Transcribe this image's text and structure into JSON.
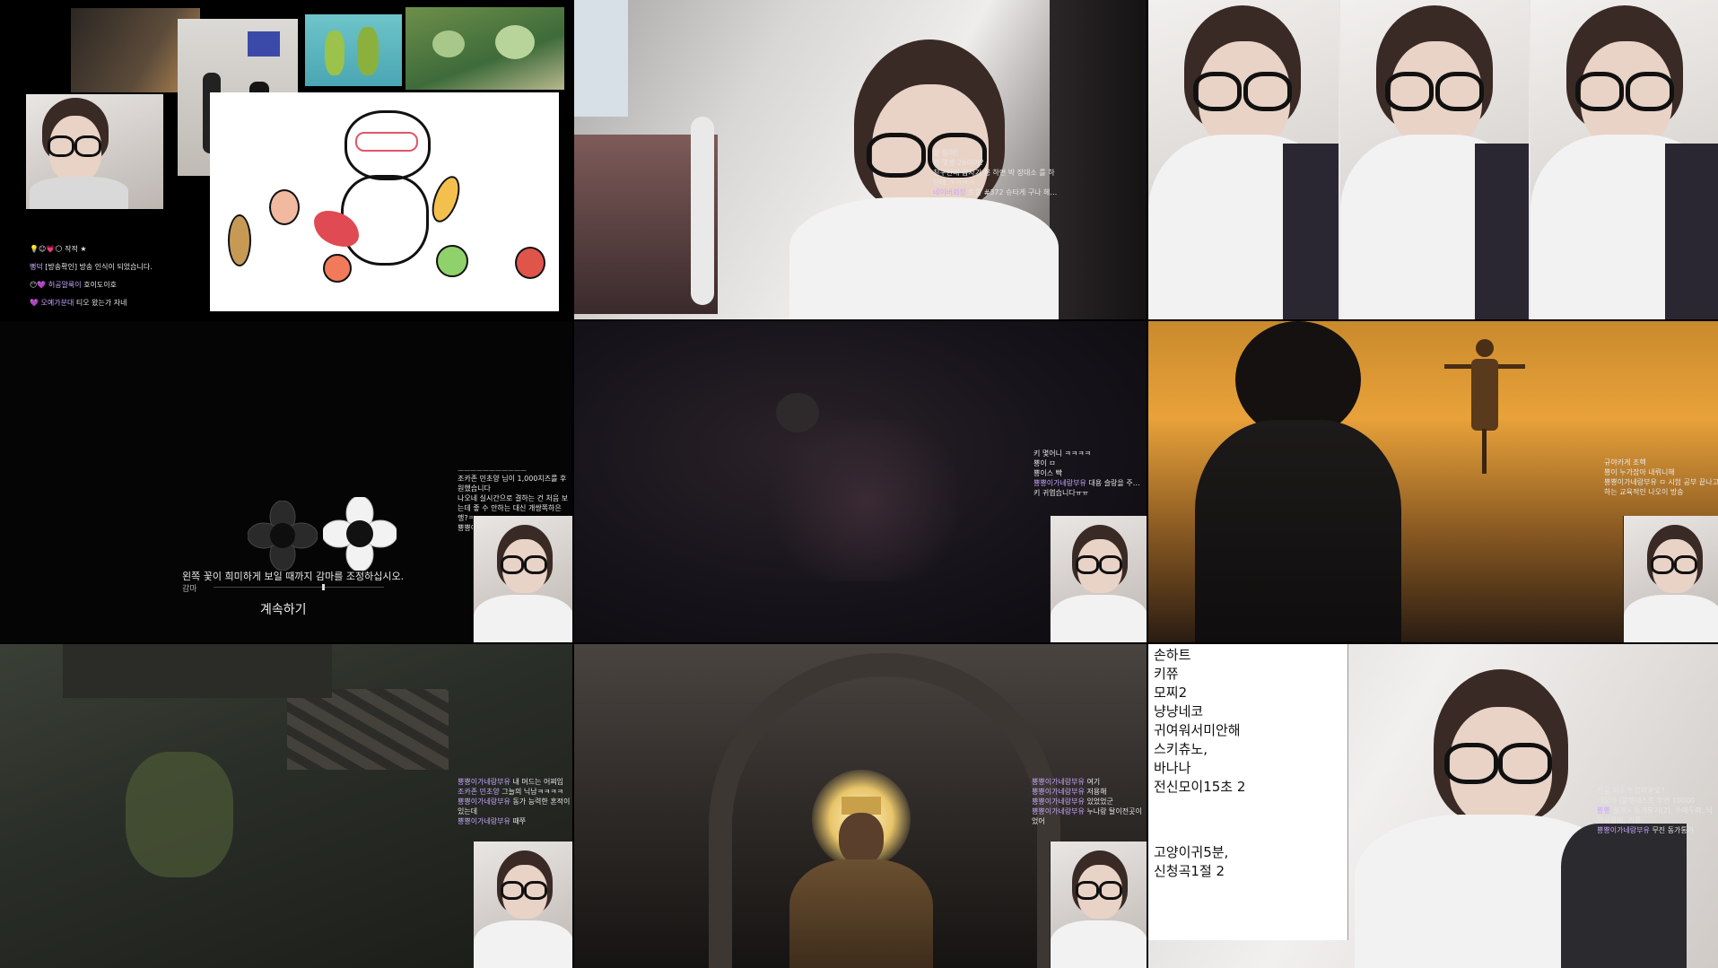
{
  "cells": {
    "c1": {
      "chat": [
        {
          "nick": "",
          "text": "작적"
        },
        {
          "nick": "뻥덕",
          "text": "[방송확인] 방송 인식이 되었습니다."
        },
        {
          "nick": "허공말룩이",
          "text": "호이도이호"
        },
        {
          "nick": "오예가분대",
          "text": "티오 왔는가 자네"
        }
      ]
    },
    "c2": {
      "chat": [
        {
          "nick": "",
          "text": "싶 용어!"
        },
        {
          "nick": "",
          "text": "키 몇짱 26이야?"
        },
        {
          "nick": "",
          "text": "친구한테 갑자기 뿅 하면 박 장대소 를 하던데 ㅋㅋㅋㅋ"
        },
        {
          "nick": "네이버회장",
          "text": "트롤 #372 슈타게 구나 헤뱃.."
        }
      ]
    },
    "c4": {
      "chat": [
        {
          "nick": "",
          "text": "조카존 민초양 님이 1,000치즈를 후원했습니다"
        },
        {
          "nick": "",
          "text": "나오네 실시간으로 결하는 건 처음 보는데 좋 수 안하는 대신 개쌍쪽하은 맹?ㅋㅋㅋㅋ"
        },
        {
          "nick": "",
          "text": "뿅뿅이가네랑부유 ㅁㅇ( ◍ )"
        }
      ],
      "gamma_instruction": "왼쪽 꽃이 희미하게 보일 때까지 감마를 조정하십시오.",
      "gamma_label": "감마",
      "continue_label": "계속하기"
    },
    "c5": {
      "chat": [
        {
          "nick": "",
          "text": "키 몇어니 ㅋㅋㅋㅋ"
        },
        {
          "nick": "",
          "text": "뿅이 ㅁ"
        },
        {
          "nick": "",
          "text": "뿅이스 빡"
        },
        {
          "nick": "뿅뿅이가네랑부유",
          "text": "대용 슬랑을 주기써"
        },
        {
          "nick": "",
          "text": "키 귀엽습니다ㅠㅠ"
        }
      ]
    },
    "c6": {
      "chat": [
        {
          "nick": "",
          "text": "규야카게 조헥"
        },
        {
          "nick": "",
          "text": "뿅이 누가잡아 내뤼니해"
        },
        {
          "nick": "",
          "text": "뿅뿅이가네랑부유 ㅁ 시험 공부 끝나고 하는 교육적인 나오이 방송"
        }
      ]
    },
    "c7": {
      "chat": [
        {
          "nick": "뿅뿅이가네랑부유",
          "text": "내 머드는 어찌임"
        },
        {
          "nick": "조카존 민초양",
          "text": "그늘의 닉남ㅋㅋㅋㅋ"
        },
        {
          "nick": "뿅뿅이가네랑부유",
          "text": "동가 능력한 혼적이 있는데"
        },
        {
          "nick": "뿅뿅이가네랑부유",
          "text": "때쭈"
        }
      ]
    },
    "c8": {
      "chat": [
        {
          "nick": "뿅뿅이가네랑부유",
          "text": "여기"
        },
        {
          "nick": "뿅뿅이가네랑부유",
          "text": "저용해"
        },
        {
          "nick": "뿅뿅이가네랑부유",
          "text": "있었었군"
        },
        {
          "nick": "뿅뿅이가네랑부유",
          "text": "누나랑 탈이전곳이었어"
        }
      ]
    },
    "c9": {
      "list": [
        "손하트",
        "키쮸",
        "모찌2",
        "냥냥네코",
        "귀여워서미안해",
        "스키츄노,",
        "바나나",
        "전신모이15초 2"
      ],
      "list2": [
        "고양이귀5분,",
        "신청곡1절 2"
      ],
      "chat": [
        {
          "nick": "",
          "text": "잔공 치수가 컵라운요?"
        },
        {
          "nick": "",
          "text": "나오이 |룰렛테스트 후연 10000"
        },
        {
          "nick": "뿅뿅",
          "text": "결과> 동가통기(2), 수마두파, 닉연사랑해, 키쮸"
        },
        {
          "nick": "뿅뿅이가네랑부유",
          "text": "무진 동가통가"
        }
      ]
    }
  },
  "colors": {
    "background": "#000000",
    "chat_nick": "#c9a7ff",
    "game_dark": "#1a1418",
    "sunset": "#e9a23a"
  }
}
